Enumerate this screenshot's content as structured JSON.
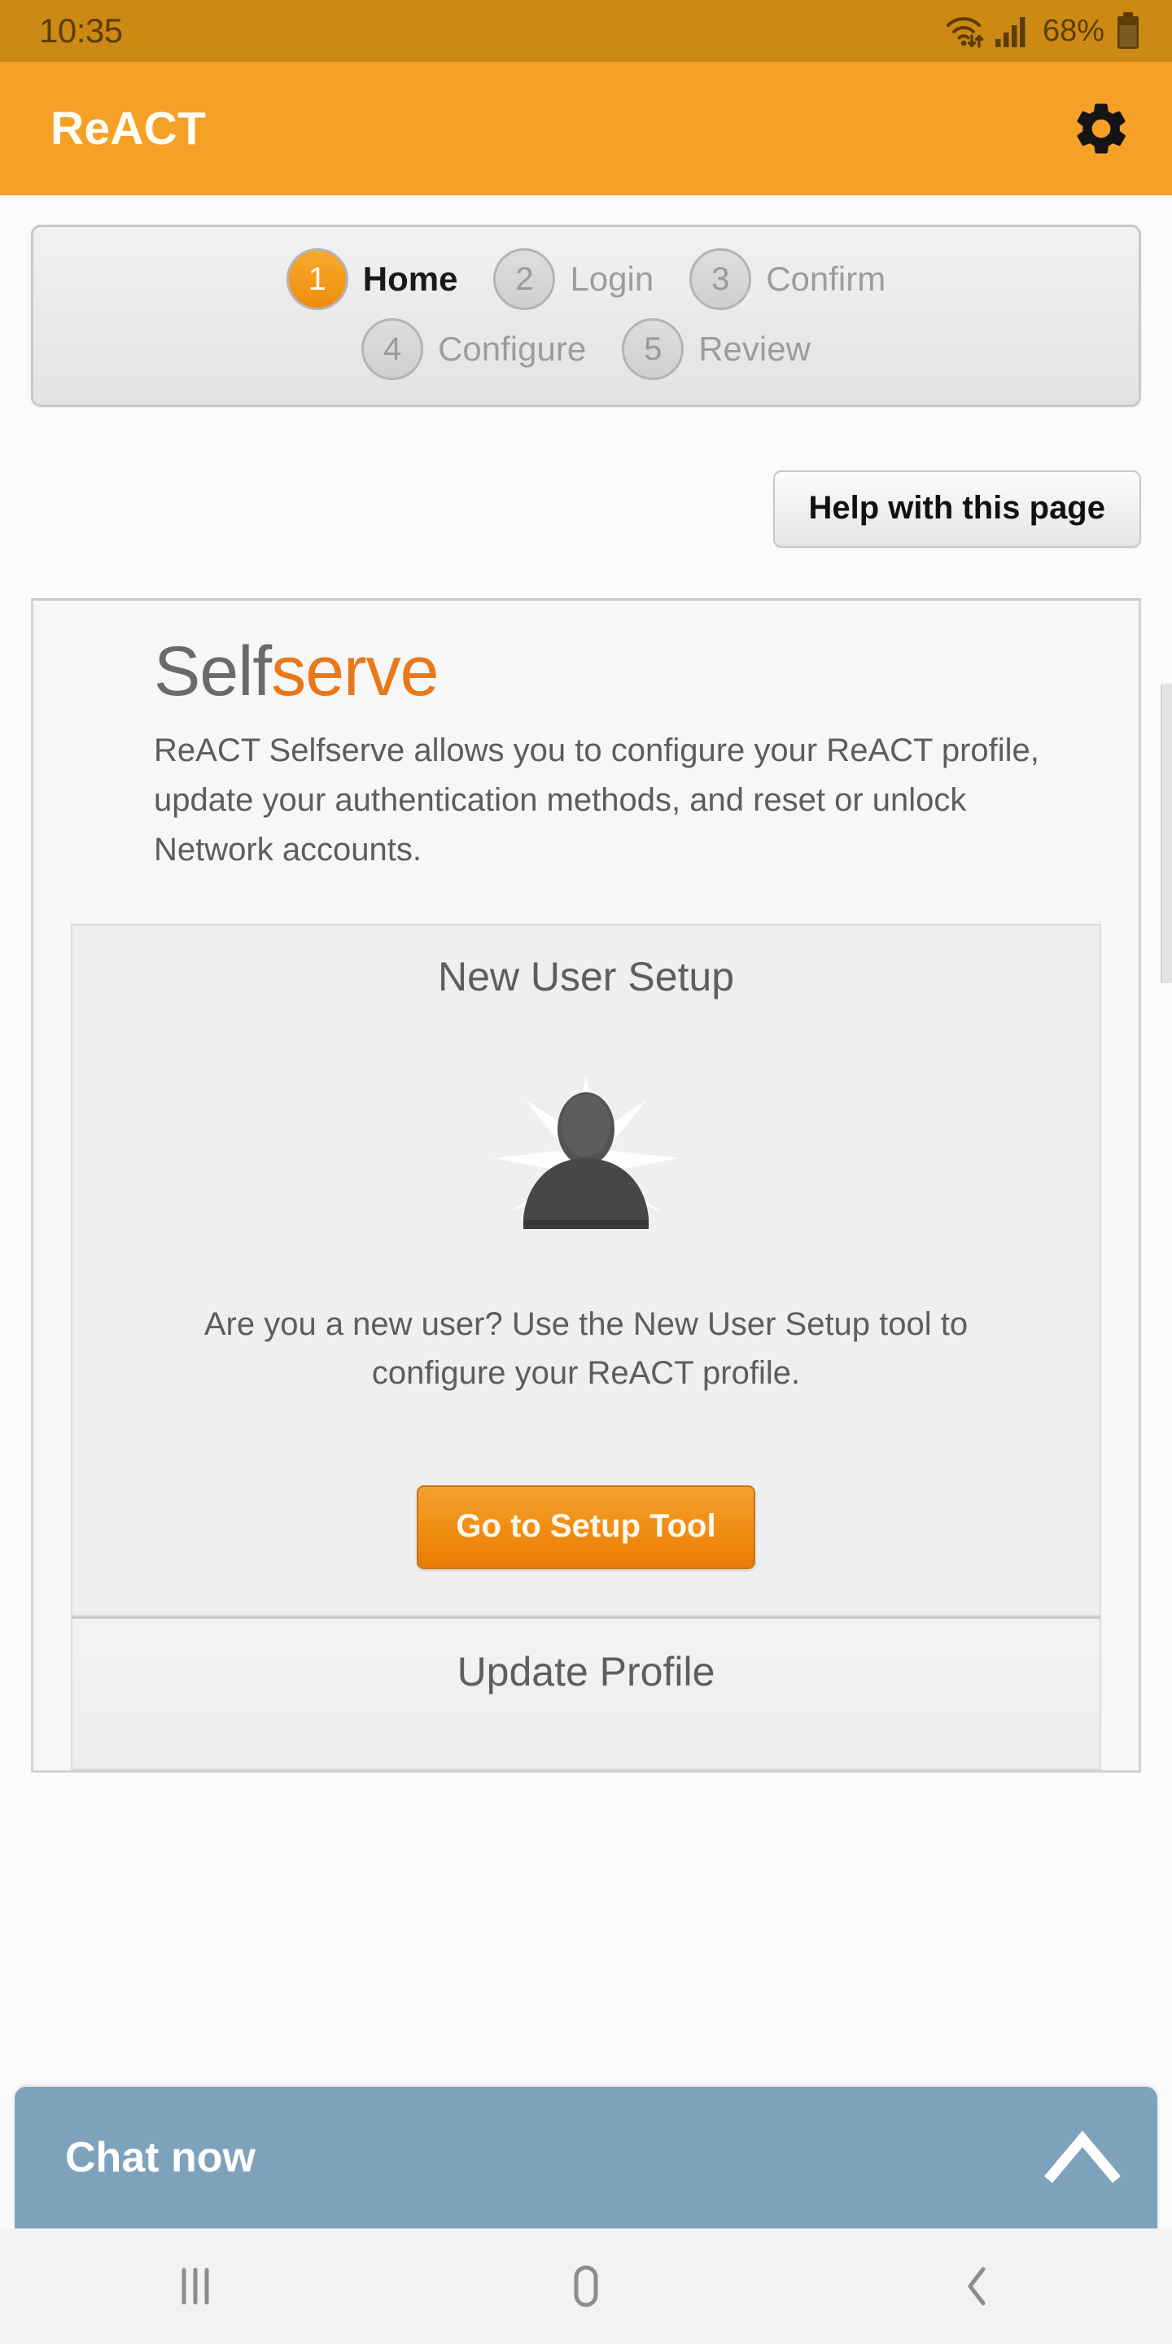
{
  "status_bar": {
    "time": "10:35",
    "battery_percent": "68%",
    "icons": [
      "wifi-icon",
      "cellular-signal-icon",
      "battery-icon"
    ]
  },
  "app_bar": {
    "title": "ReACT",
    "settings_icon": "gear-icon"
  },
  "stepper": {
    "rows": [
      [
        {
          "number": "1",
          "label": "Home",
          "active": true
        },
        {
          "number": "2",
          "label": "Login",
          "active": false
        },
        {
          "number": "3",
          "label": "Confirm",
          "active": false
        }
      ],
      [
        {
          "number": "4",
          "label": "Configure",
          "active": false
        },
        {
          "number": "5",
          "label": "Review",
          "active": false
        }
      ]
    ]
  },
  "help": {
    "label": "Help with this page"
  },
  "content": {
    "brand_first": "Self",
    "brand_second": "serve",
    "intro": "ReACT Selfserve allows you to configure your ReACT profile, update your authentication methods, and reset or unlock Network accounts.",
    "new_user_setup": {
      "title": "New User Setup",
      "avatar_icon": "user-silhouette-icon",
      "description": "Are you a new user? Use the New User Setup tool to configure your ReACT profile.",
      "button_label": "Go to Setup Tool"
    },
    "update_profile": {
      "title": "Update Profile"
    }
  },
  "chat": {
    "label": "Chat now",
    "expand_icon": "chevron-up-icon"
  },
  "nav_bar": {
    "recents_icon": "recents-icon",
    "home_icon": "home-icon",
    "back_icon": "back-icon"
  },
  "colors": {
    "status_bar_bg": "#cc8a14",
    "app_bar_bg": "#f5a026",
    "accent_orange": "#e8781a",
    "chat_bar_bg": "#7ea2bb",
    "page_bg": "#fbfbfb"
  }
}
